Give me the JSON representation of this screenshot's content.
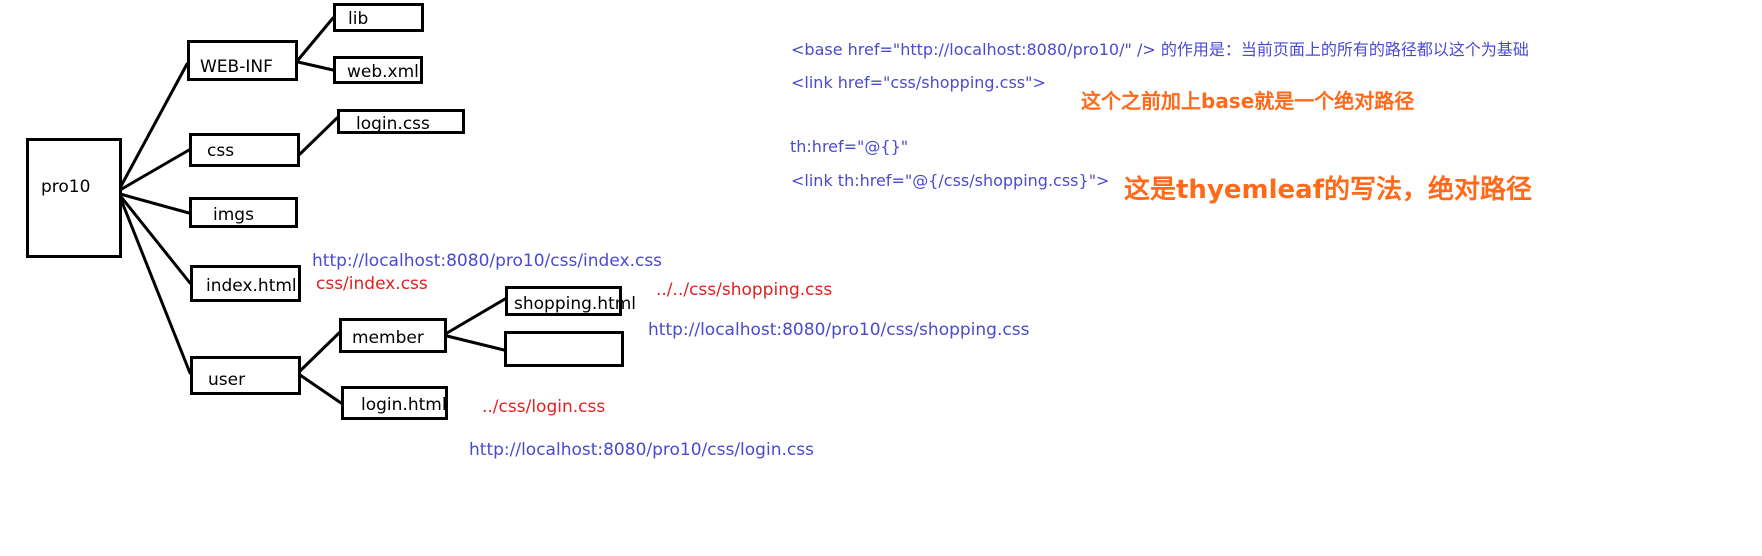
{
  "tree": {
    "root": "pro10",
    "web_inf": "WEB-INF",
    "lib": "lib",
    "web_xml": "web.xml",
    "css": "css",
    "login_css": "login.css",
    "imgs": "imgs",
    "index_html": "index.html",
    "user": "user",
    "member": "member",
    "shopping_html": "shopping.html",
    "blank": "",
    "login_html": "login.html"
  },
  "paths": {
    "index_absolute": "http://localhost:8080/pro10/css/index.css",
    "index_relative": "css/index.css",
    "shopping_relative": "../../css/shopping.css",
    "shopping_absolute": "http://localhost:8080/pro10/css/shopping.css",
    "login_relative": "../css/login.css",
    "login_absolute": "http://localhost:8080/pro10/css/login.css"
  },
  "notes": {
    "base_tag": "<base href=\"http://localhost:8080/pro10/\" /> 的作用是：当前页面上的所有的路径都以这个为基础",
    "link_tag": "<link href=\"css/shopping.css\">",
    "base_comment": "这个之前加上base就是一个绝对路径",
    "th_href": "th:href=\"@{}\"",
    "th_link": "<link th:href=\"@{/css/shopping.css}\">",
    "thymeleaf_comment": "这是thyemleaf的写法，绝对路径"
  },
  "colors": {
    "tree_line": "#000000",
    "absolute_path": "#4a4ad0",
    "relative_path": "#e02020",
    "comment": "#ff6a1a"
  }
}
